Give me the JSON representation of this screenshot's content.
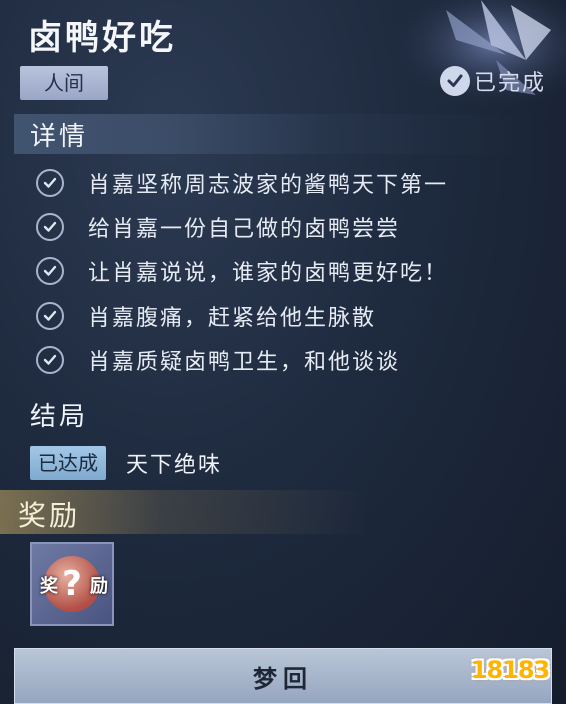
{
  "quest": {
    "title": "卤鸭好吃",
    "realm": "人间",
    "status": "已完成"
  },
  "details": {
    "heading": "详情",
    "tasks": [
      {
        "text": "肖嘉坚称周志波家的酱鸭天下第一",
        "done": true
      },
      {
        "text": "给肖嘉一份自己做的卤鸭尝尝",
        "done": true
      },
      {
        "text": "让肖嘉说说，谁家的卤鸭更好吃！",
        "done": true
      },
      {
        "text": "肖嘉腹痛，赶紧给他生脉散",
        "done": true
      },
      {
        "text": "肖嘉质疑卤鸭卫生，和他谈谈",
        "done": true
      }
    ]
  },
  "ending": {
    "heading": "结局",
    "achieved_label": "已达成",
    "name": "天下绝味"
  },
  "reward": {
    "heading": "奖励",
    "item_label_left": "奖",
    "item_label_right": "励",
    "item_icon": "question-orb-icon"
  },
  "actions": {
    "dream_button": "梦回"
  },
  "watermark": {
    "text": "18183"
  },
  "colors": {
    "background": "#1e2a3e",
    "realm_tag": "#aab4d0",
    "achieved_tag": "#8fb6da",
    "reward_glow": "#c8aa64",
    "watermark": "#ffb400"
  }
}
